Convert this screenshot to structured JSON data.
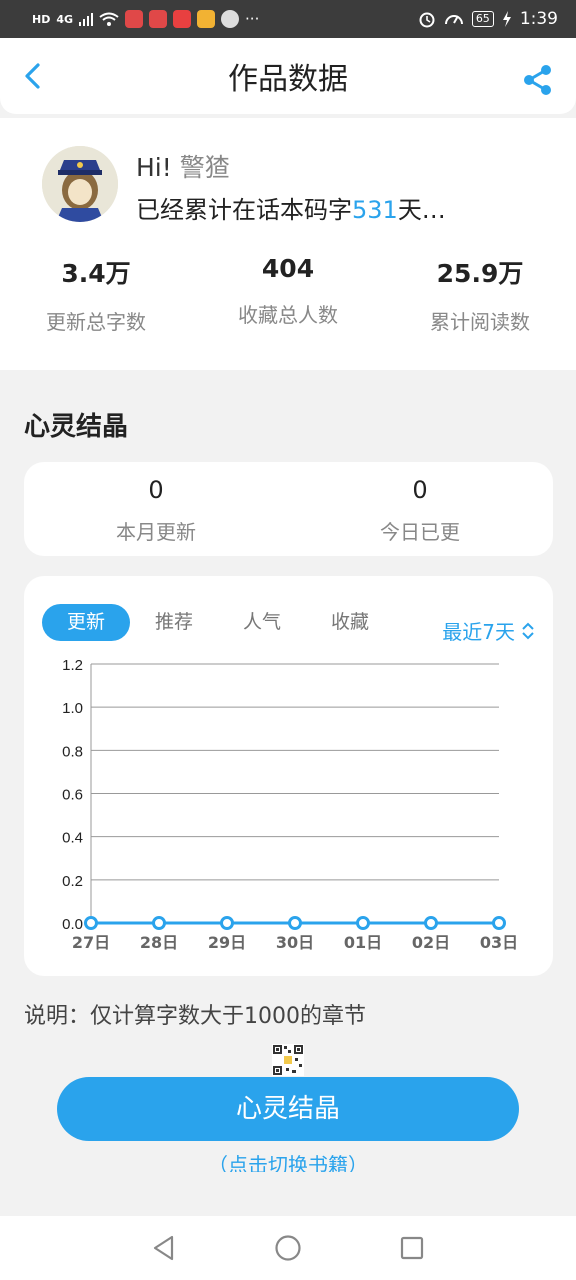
{
  "status_bar": {
    "left_indicators": [
      "HD",
      "4G"
    ],
    "battery": "65",
    "time": "1:39"
  },
  "nav": {
    "title": "作品数据"
  },
  "profile": {
    "greeting": "Hi!",
    "name": "警猹",
    "streak_prefix": "已经累计在话本码字",
    "streak_days": "531",
    "streak_suffix": "天…",
    "stats": [
      {
        "value": "3.4万",
        "label": "更新总字数"
      },
      {
        "value": "404",
        "label": "收藏总人数"
      },
      {
        "value": "25.9万",
        "label": "累计阅读数"
      }
    ]
  },
  "section": {
    "title": "心灵结晶"
  },
  "counters": [
    {
      "value": "0",
      "label": "本月更新"
    },
    {
      "value": "0",
      "label": "今日已更"
    }
  ],
  "chart_panel": {
    "tabs": [
      "更新",
      "推荐",
      "人气",
      "收藏"
    ],
    "active_tab": 0,
    "range_label": "最近7天"
  },
  "chart_data": {
    "type": "line",
    "categories": [
      "27日",
      "28日",
      "29日",
      "30日",
      "01日",
      "02日",
      "03日"
    ],
    "series": [
      {
        "values": [
          0,
          0,
          0,
          0,
          0,
          0,
          0
        ]
      }
    ],
    "y_ticks": [
      "0.0",
      "0.2",
      "0.4",
      "0.6",
      "0.8",
      "1.0",
      "1.2"
    ],
    "ylim": [
      0,
      1.2
    ],
    "grid": true,
    "line_color": "#2aa3ec"
  },
  "note": "说明：仅计算字数大于1000的章节",
  "main_button": "心灵结晶",
  "switch_link": "（点击切换书籍）",
  "colors": {
    "accent": "#2aa3ec"
  }
}
